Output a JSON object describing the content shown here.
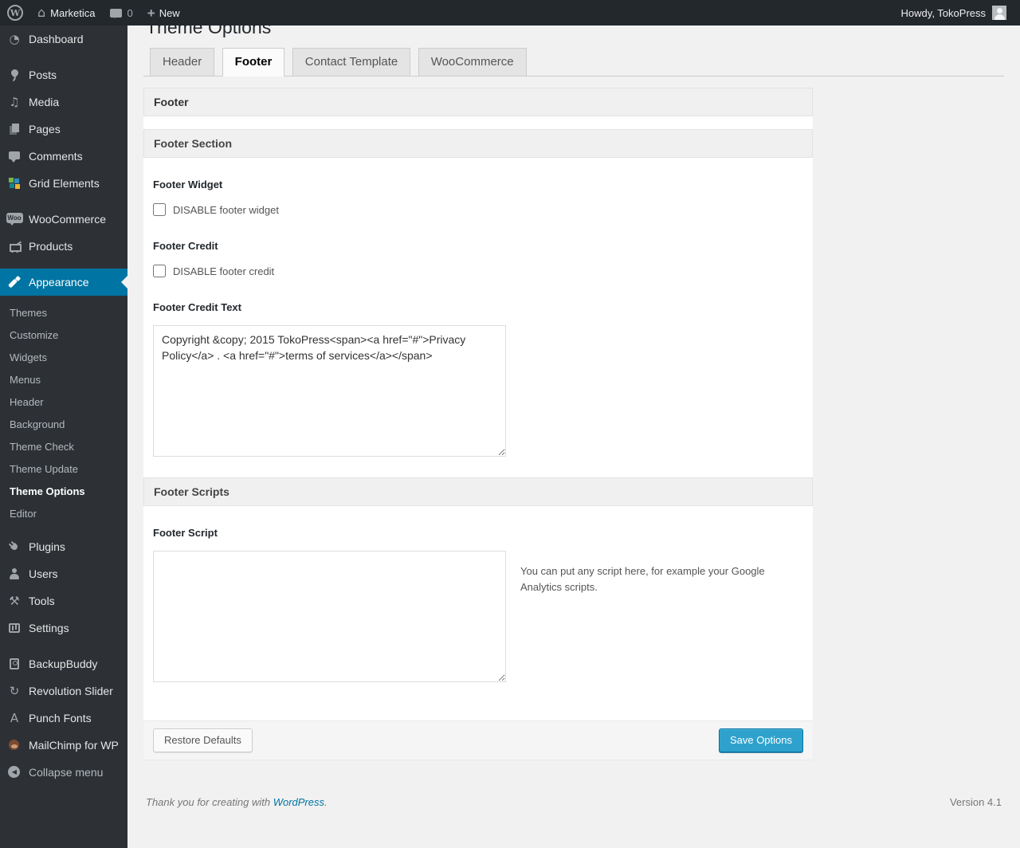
{
  "admin_bar": {
    "site_name": "Marketica",
    "comment_count": "0",
    "new_label": "New",
    "howdy": "Howdy, TokoPress"
  },
  "icons": {
    "wp_logo_glyph": "W",
    "home_glyph": "⌂",
    "plus_glyph": "+",
    "dashboard_glyph": "◔",
    "media_glyph": "♫",
    "tools_glyph": "⚒",
    "revslider_glyph": "↻",
    "punch_fonts_glyph": "A",
    "woo_badge_text": "Woo",
    "collapse_glyph": "◀"
  },
  "sidebar": {
    "items": [
      {
        "label": "Dashboard",
        "icon": "dashboard-icon"
      },
      {
        "label": "Posts",
        "icon": "pushpin-icon"
      },
      {
        "label": "Media",
        "icon": "media-icon"
      },
      {
        "label": "Pages",
        "icon": "pages-icon"
      },
      {
        "label": "Comments",
        "icon": "comment-bubble-icon"
      },
      {
        "label": "Grid Elements",
        "icon": "grid-elements-icon"
      },
      {
        "label": "WooCommerce",
        "icon": "woocommerce-badge-icon"
      },
      {
        "label": "Products",
        "icon": "cart-icon"
      },
      {
        "label": "Appearance",
        "icon": "paintbrush-icon"
      },
      {
        "label": "Plugins",
        "icon": "plug-icon"
      },
      {
        "label": "Users",
        "icon": "person-icon"
      },
      {
        "label": "Tools",
        "icon": "tools-icon"
      },
      {
        "label": "Settings",
        "icon": "settings-sliders-icon"
      },
      {
        "label": "BackupBuddy",
        "icon": "backup-drive-icon"
      },
      {
        "label": "Revolution Slider",
        "icon": "refresh-arrows-icon"
      },
      {
        "label": "Punch Fonts",
        "icon": "letter-a-icon"
      },
      {
        "label": "MailChimp for WP",
        "icon": "monkey-icon"
      },
      {
        "label": "Collapse menu",
        "icon": "collapse-arrow-icon"
      }
    ],
    "appearance_submenu": [
      "Themes",
      "Customize",
      "Widgets",
      "Menus",
      "Header",
      "Background",
      "Theme Check",
      "Theme Update",
      "Theme Options",
      "Editor"
    ]
  },
  "theme_options": {
    "title": "Theme Options",
    "tabs": [
      "Header",
      "Footer",
      "Contact Template",
      "WooCommerce"
    ],
    "group_title": "Footer",
    "section1_title": "Footer Section",
    "footer_widget_label": "Footer Widget",
    "footer_widget_checkbox": "DISABLE footer widget",
    "footer_credit_label": "Footer Credit",
    "footer_credit_checkbox": "DISABLE footer credit",
    "footer_credit_text_label": "Footer Credit Text",
    "footer_credit_text_value": "Copyright &copy; 2015 TokoPress<span><a href=\"#\">Privacy Policy</a> . <a href=\"#\">terms of services</a></span>",
    "section2_title": "Footer Scripts",
    "footer_script_label": "Footer Script",
    "footer_script_value": "",
    "footer_script_help": "You can put any script here, for example your Google Analytics scripts.",
    "restore_button": "Restore Defaults",
    "save_button": "Save Options"
  },
  "footer": {
    "thanks_prefix": "Thank you for creating with ",
    "wordpress_link": "WordPress",
    "thanks_suffix": ".",
    "version": "Version 4.1"
  },
  "colors": {
    "admin_bar_bg": "#23282d",
    "sidebar_bg": "#2d3136",
    "highlight": "#0074a2",
    "primary_button": "#2ea2cc",
    "link": "#0074a2",
    "page_bg": "#f1f1f1"
  }
}
